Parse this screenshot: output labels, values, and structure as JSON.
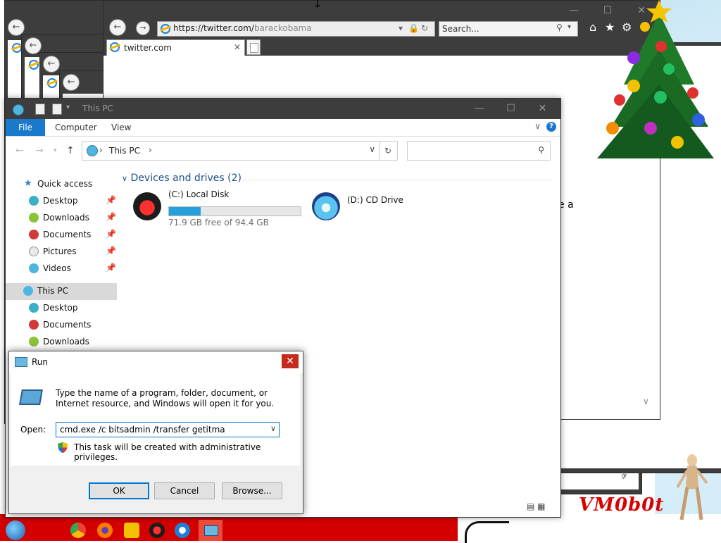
{
  "browser": {
    "url_host": "https://twitter.com/",
    "url_path": "barackobama",
    "search_placeholder": "Search...",
    "tab_title": "twitter.com",
    "page_fragment": "e a"
  },
  "explorer": {
    "title": "This PC",
    "ribbon_tabs": [
      "File",
      "Computer",
      "View"
    ],
    "address_crumb": "This PC",
    "nav": {
      "quick_access": "Quick access",
      "quick_items": [
        "Desktop",
        "Downloads",
        "Documents",
        "Pictures",
        "Videos"
      ],
      "this_pc": "This PC",
      "pc_items": [
        "Desktop",
        "Documents",
        "Downloads"
      ]
    },
    "group_header": "Devices and drives (2)",
    "drives": [
      {
        "name": "(C:) Local Disk",
        "free_text": "71.9 GB free of 94.4 GB",
        "used_fraction": 0.238
      },
      {
        "name": "(D:) CD Drive"
      }
    ]
  },
  "run": {
    "title": "Run",
    "description": "Type the name of a program, folder, document, or Internet resource, and Windows will open it for you.",
    "open_label": "Open:",
    "command": "cmd.exe /c bitsadmin /transfer getitma",
    "admin_note": "This task will be created with administrative privileges.",
    "ok": "OK",
    "cancel": "Cancel",
    "browse": "Browse..."
  },
  "desktop": {
    "watermark": "VM0b0t"
  },
  "colors": {
    "accent": "#1979ca",
    "titlebar_dark": "#3d3d3d",
    "close_red": "#c42b1c",
    "desktop_red": "#d40000"
  }
}
